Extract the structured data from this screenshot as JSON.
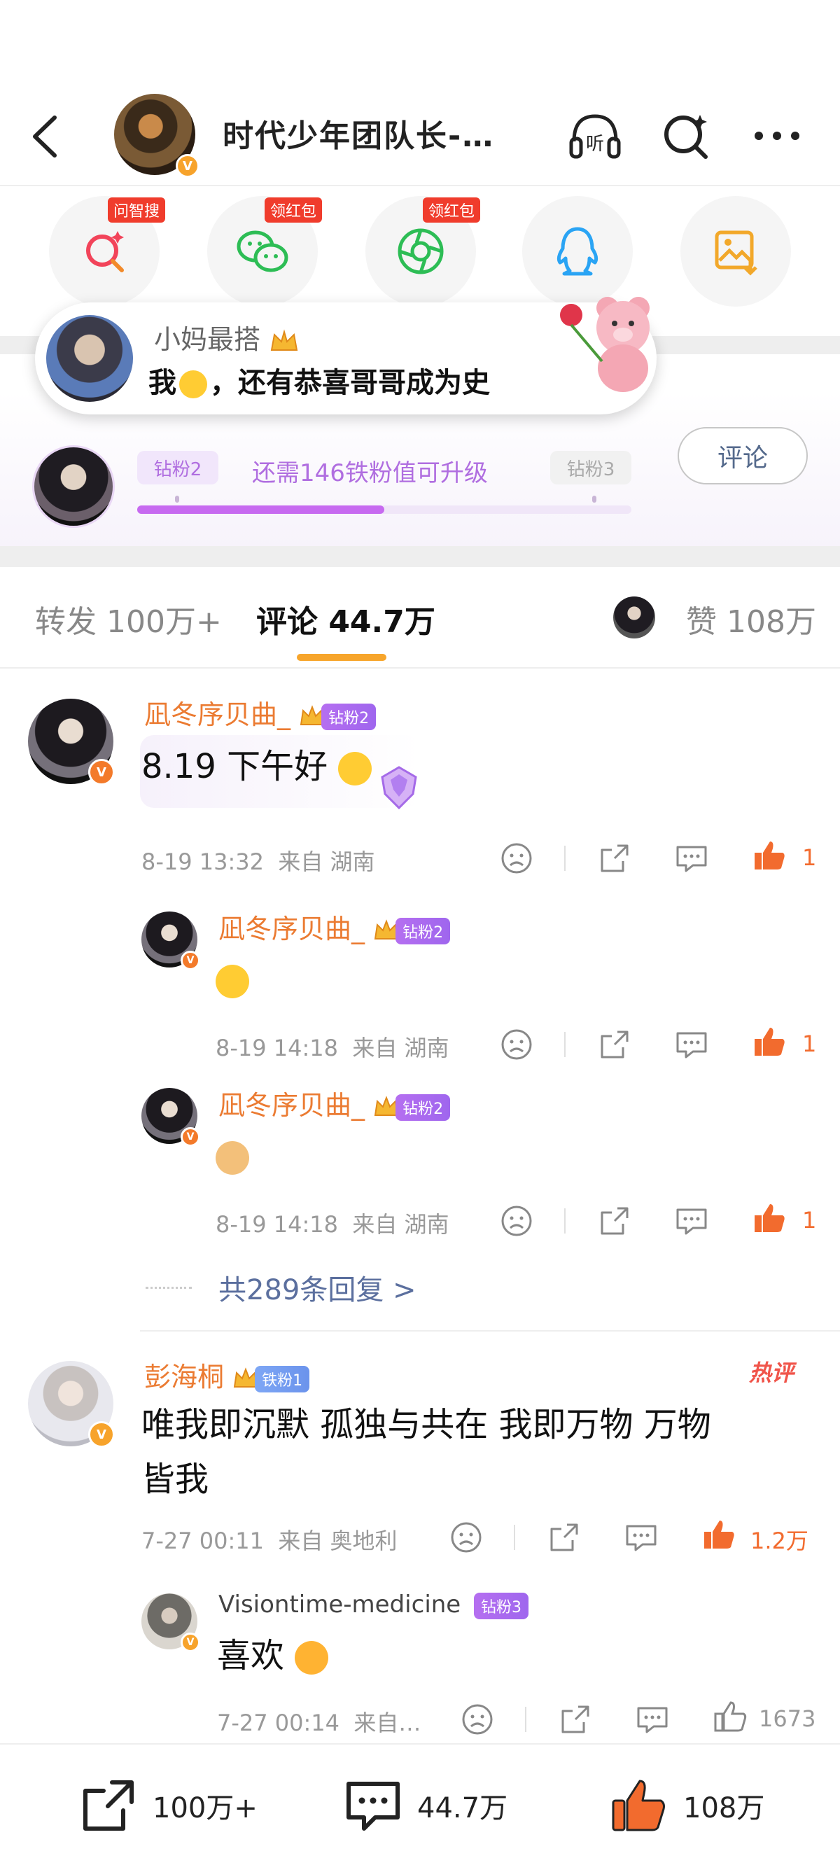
{
  "header": {
    "title": "时代少年团队长-…",
    "listen_label": "听"
  },
  "share_row": [
    {
      "tag": "问智搜",
      "icon": "ai-search-icon"
    },
    {
      "tag": "领红包",
      "icon": "wechat-icon"
    },
    {
      "tag": "领红包",
      "icon": "moments-icon"
    },
    {
      "tag": "",
      "icon": "qq-icon"
    },
    {
      "tag": "",
      "icon": "save-image-icon"
    }
  ],
  "toast": {
    "name": "小妈最搭",
    "message_prefix": "我",
    "message_suffix": "，还有恭喜哥哥成为史"
  },
  "fan_card": {
    "current_level": "钻粉2",
    "next_level": "钻粉3",
    "hint": "还需146铁粉值可升级",
    "progress": 0.5,
    "comment_button": "评论"
  },
  "tabs": {
    "repost": "转发 100万+",
    "comments": "评论 44.7万",
    "likes": "赞 108万"
  },
  "comments": [
    {
      "name": "凪冬序贝曲_",
      "fan_tag": "钻粉2",
      "text": "8.19 下午好",
      "time": "8-19 13:32",
      "location": "来自 湖南",
      "likes": "1",
      "replies": [
        {
          "name": "凪冬序贝曲_",
          "fan_tag": "钻粉2",
          "time": "8-19 14:18",
          "location": "来自 湖南",
          "likes": "1"
        },
        {
          "name": "凪冬序贝曲_",
          "fan_tag": "钻粉2",
          "time": "8-19 14:18",
          "location": "来自 湖南",
          "likes": "1"
        }
      ],
      "more_replies": "共289条回复 >"
    },
    {
      "name": "彭海桐",
      "fan_tag": "铁粉1",
      "hot": "热评",
      "text_line1": "唯我即沉默 孤独与共在 我即万物 万物",
      "text_line2": "皆我",
      "time": "7-27 00:11",
      "location": "来自 奥地利",
      "likes": "1.2万",
      "replies": [
        {
          "name": "Visiontime-medicine",
          "fan_tag": "钻粉3",
          "text": "喜欢",
          "time": "7-27 00:14",
          "location": "来自…",
          "likes": "1673"
        }
      ]
    }
  ],
  "bottom_bar": {
    "repost": "100万+",
    "comments": "44.7万",
    "likes": "108万"
  },
  "colors": {
    "accent_orange": "#f26b2e",
    "name_orange": "#eb7b32",
    "fan_purple": "#b06ee0",
    "tab_underline": "#f7a52b"
  }
}
